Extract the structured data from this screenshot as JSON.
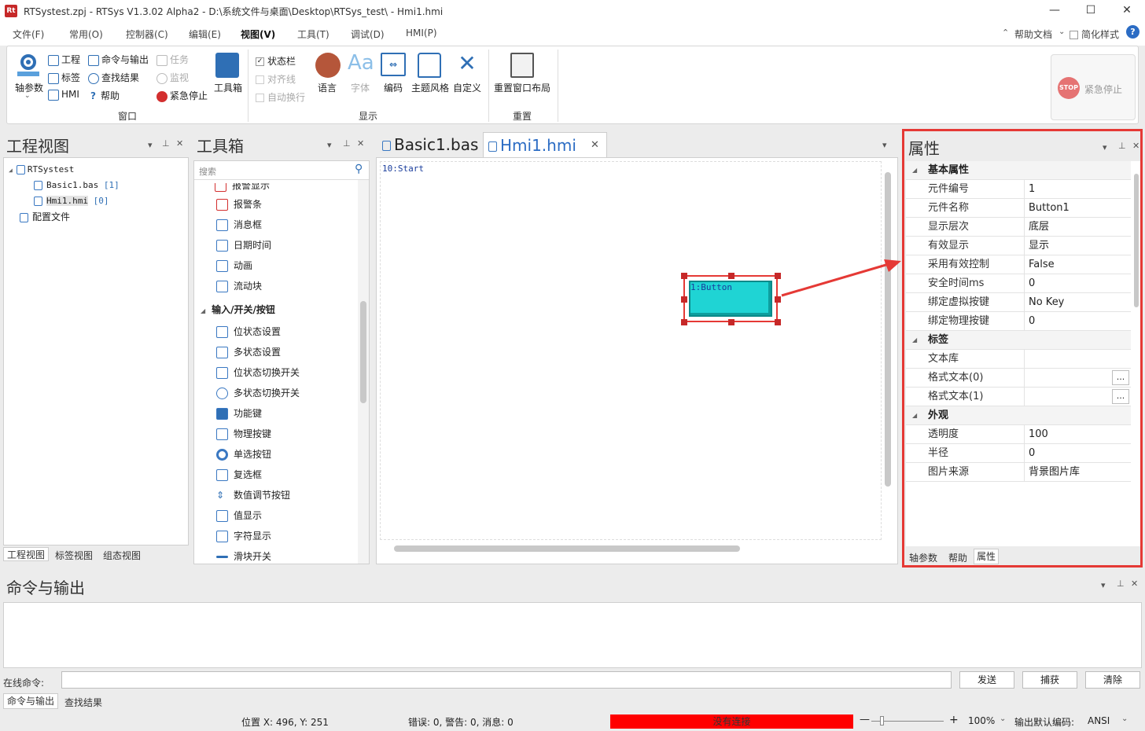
{
  "titlebar": {
    "title": "RTSystest.zpj - RTSys V1.3.02 Alpha2 - D:\\系统文件与桌面\\Desktop\\RTSys_test\\ - Hmi1.hmi",
    "logo": "Rt",
    "min": "—",
    "max": "☐",
    "close": "✕"
  },
  "menu": {
    "items": [
      "文件(F)",
      "常用(O)",
      "控制器(C)",
      "编辑(E)",
      "视图(V)",
      "工具(T)",
      "调试(D)",
      "HMI(P)"
    ],
    "help_doc": "帮助文档",
    "simple_style": "简化样式",
    "help_icon": "?"
  },
  "ribbon": {
    "axis_param": "轴参数",
    "project": "工程",
    "labels": "标签",
    "hmi": "HMI",
    "cmd_output": "命令与输出",
    "find_results": "查找结果",
    "help": "帮助",
    "task": "任务",
    "monitor": "监视",
    "estop": "紧急停止",
    "toolbox": "工具箱",
    "group_window": "窗口",
    "statusbar": "状态栏",
    "align_bar": "对齐线",
    "auto_wrap": "自动换行",
    "language": "语言",
    "font": "字体",
    "encoding": "编码",
    "theme": "主题风格",
    "custom": "自定义",
    "group_display": "显示",
    "reset_layout": "重置窗口布局",
    "group_reset": "重置",
    "emergency_stop": "紧急停止",
    "stop_badge": "STOP"
  },
  "project_view": {
    "title": "工程视图",
    "root": "RTSystest",
    "items": [
      {
        "name": "Basic1.bas",
        "tag": "[1]"
      },
      {
        "name": "Hmi1.hmi",
        "tag": "[0]"
      }
    ],
    "config": "配置文件",
    "tabs": [
      "工程视图",
      "标签视图",
      "组态视图"
    ]
  },
  "toolbox": {
    "title": "工具箱",
    "search_placeholder": "搜索",
    "cut_top": "报警显示",
    "items1": [
      "报警条",
      "消息框",
      "日期时间",
      "动画",
      "流动块"
    ],
    "category": "输入/开关/按钮",
    "items2": [
      "位状态设置",
      "多状态设置",
      "位状态切换开关",
      "多状态切换开关",
      "功能键",
      "物理按键",
      "单选按钮",
      "复选框",
      "数值调节按钮",
      "值显示",
      "字符显示",
      "滑块开关"
    ]
  },
  "editor": {
    "tabs": [
      {
        "label": "Basic1.bas"
      },
      {
        "label": "Hmi1.hmi"
      }
    ],
    "code_line": "10:Start",
    "button_label": "1:Button"
  },
  "properties": {
    "title": "属性",
    "cat_basic": "基本属性",
    "basic": [
      {
        "k": "元件编号",
        "v": "1"
      },
      {
        "k": "元件名称",
        "v": "Button1"
      },
      {
        "k": "显示层次",
        "v": "底层"
      },
      {
        "k": "有效显示",
        "v": "显示"
      },
      {
        "k": "采用有效控制",
        "v": "False"
      },
      {
        "k": "安全时间ms",
        "v": "0"
      },
      {
        "k": "绑定虚拟按键",
        "v": "No Key"
      },
      {
        "k": "绑定物理按键",
        "v": "0"
      }
    ],
    "cat_label": "标签",
    "label": [
      {
        "k": "文本库",
        "v": ""
      },
      {
        "k": "格式文本(0)",
        "v": ""
      },
      {
        "k": "格式文本(1)",
        "v": ""
      }
    ],
    "cat_look": "外观",
    "look": [
      {
        "k": "透明度",
        "v": "100"
      },
      {
        "k": "半径",
        "v": "0"
      },
      {
        "k": "图片来源",
        "v": "背景图片库"
      }
    ],
    "tabs": [
      "轴参数",
      "帮助",
      "属性"
    ],
    "ellipsis": "..."
  },
  "output": {
    "title": "命令与输出",
    "online_label": "在线命令:",
    "send": "发送",
    "capture": "捕获",
    "clear": "清除",
    "tabs": [
      "命令与输出",
      "查找结果"
    ]
  },
  "status": {
    "pos": "位置 X: 496, Y: 251",
    "errors": "错误: 0, 警告: 0, 消息: 0",
    "connection": "没有连接",
    "zoom": "100%",
    "encoding_label": "输出默认编码:",
    "encoding": "ANSI"
  },
  "colors": {
    "accent_red": "#e53935",
    "cyan_button": "#1fd4d4",
    "conn_red": "#ff0000"
  }
}
